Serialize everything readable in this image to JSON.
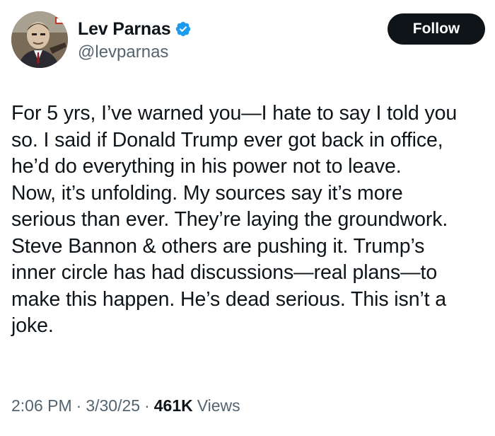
{
  "author": {
    "display_name": "Lev Parnas",
    "handle": "@levparnas",
    "verified_icon": "verified-badge-icon",
    "verified_color": "#1d9bf0"
  },
  "follow_button": {
    "label": "Follow"
  },
  "tweet": {
    "text": "For 5 yrs, I’ve warned you—I hate to say I told you\nso. I said if Donald Trump ever got back in office,\nhe’d do everything in his power not to leave.\nNow, it’s unfolding. My sources say it’s more\nserious than ever. They’re laying the groundwork.\nSteve Bannon & others are pushing it. Trump’s\ninner circle has had discussions—real plans—to\nmake this happen. He’s dead serious. This isn’t a\njoke."
  },
  "meta": {
    "time": "2:06 PM",
    "separator": "·",
    "date": "3/30/25",
    "views_count": "461K",
    "views_label": "Views"
  },
  "colors": {
    "text_primary": "#0f1419",
    "text_secondary": "#536471",
    "button_bg": "#0f1419",
    "button_text": "#ffffff"
  }
}
